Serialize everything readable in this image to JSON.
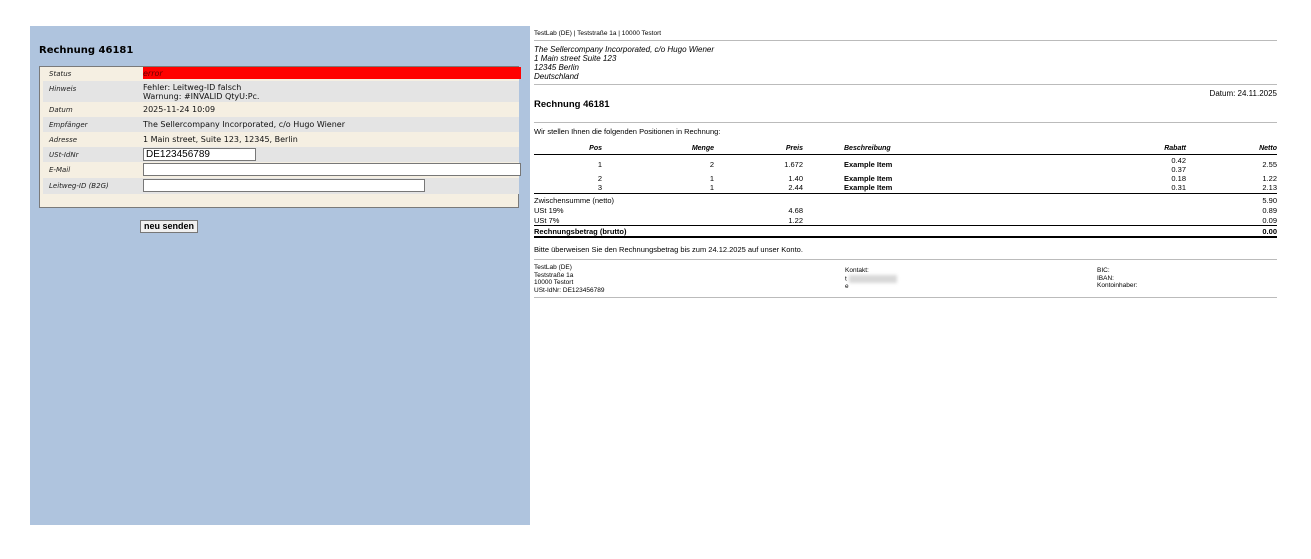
{
  "form": {
    "title": "Rechnung 46181",
    "labels": {
      "status": "Status",
      "hinweis": "Hinweis",
      "datum": "Datum",
      "empfaenger": "Empfänger",
      "adresse": "Adresse",
      "ustid": "USt-IdNr",
      "email": "E-Mail",
      "leitweg": "Leitweg-ID (B2G)"
    },
    "values": {
      "status": "error",
      "hinweis_line1": "Fehler: Leitweg-ID falsch",
      "hinweis_line2": "Warnung: #INVALID QtyU:Pc.",
      "datum": "2025-11-24 10:09",
      "empfaenger": "The Sellercompany Incorporated, c/o Hugo Wiener",
      "adresse": "1 Main street, Suite 123, 12345, Berlin",
      "ustid": "DE123456789",
      "email": "",
      "leitweg": ""
    },
    "button_label": "neu senden",
    "status_color": "#ff0000"
  },
  "invoice": {
    "sender_line": "TestLab (DE) | Teststraße 1a | 10000 Testort",
    "recipient": [
      "The Sellercompany Incorporated, c/o Hugo Wiener",
      "1 Main street Suite 123",
      "12345 Berlin",
      "Deutschland"
    ],
    "date": "Datum: 24.11.2025",
    "title": "Rechnung 46181",
    "intro": "Wir stellen Ihnen die folgenden Positionen in Rechnung:",
    "columns": {
      "pos": "Pos",
      "menge": "Menge",
      "preis": "Preis",
      "beschreibung": "Beschreibung",
      "rabatt": "Rabatt",
      "netto": "Netto"
    },
    "items": [
      {
        "pos": "1",
        "menge": "2",
        "preis": "1.672",
        "beschreibung": "Example Item",
        "rabatt1": "0.42",
        "rabatt2": "0.37",
        "netto": "2.55"
      },
      {
        "pos": "2",
        "menge": "1",
        "preis": "1.40",
        "beschreibung": "Example Item",
        "rabatt1": "0.18",
        "netto": "1.22"
      },
      {
        "pos": "3",
        "menge": "1",
        "preis": "2.44",
        "beschreibung": "Example Item",
        "rabatt1": "0.31",
        "netto": "2.13"
      }
    ],
    "subtotal_label": "Zwischensumme (netto)",
    "subtotal": "5.90",
    "vat19_label": "USt 19%",
    "vat19_base": "4.68",
    "vat19": "0.89",
    "vat7_label": "USt 7%",
    "vat7_base": "1.22",
    "vat7": "0.09",
    "total_label": "Rechnungsbetrag (brutto)",
    "total": "0.00",
    "payment_note": "Bitte überweisen Sie den Rechnungsbetrag bis zum 24.12.2025 auf unser Konto.",
    "footer": {
      "col1": [
        "TestLab (DE)",
        "Teststraße 1a",
        "10000 Testort",
        "USt-IdNr: DE123456789"
      ],
      "kontakt": "Kontakt:",
      "t": "t",
      "e": "e",
      "bic": "BIC:",
      "iban": "IBAN:",
      "kontoinhaber": "Kontoinhaber:"
    }
  }
}
